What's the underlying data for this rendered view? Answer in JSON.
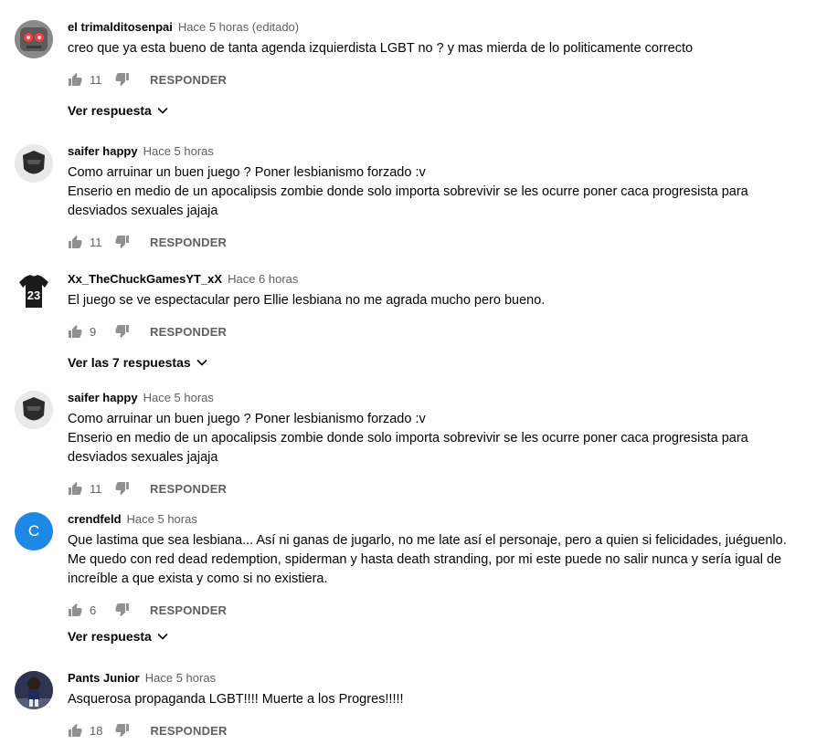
{
  "comments": [
    {
      "author": "el trimalditosenpai",
      "time": "Hace 5 horas (editado)",
      "text": "creo que ya esta bueno de tanta agenda izquierdista LGBT no ? y mas mierda de lo politicamente correcto",
      "likes": "11",
      "reply_label": "RESPONDER",
      "replies_toggle": "Ver respuesta",
      "avatar": "robot-avatar"
    },
    {
      "author": "saifer happy",
      "time": "Hace 5 horas",
      "text": "Como arruinar un buen juego ? Poner lesbianismo forzado :v\nEnserio en medio de un apocalipsis zombie donde solo importa sobrevivir se les ocurre poner caca progresista para desviados sexuales jajaja",
      "likes": "11",
      "reply_label": "RESPONDER",
      "avatar": "helmet-avatar"
    },
    {
      "author": "Xx_TheChuckGamesYT_xX",
      "time": "Hace 6 horas",
      "text": "El juego se ve espectacular pero Ellie lesbiana no me agrada mucho pero bueno.",
      "likes": "9",
      "reply_label": "RESPONDER",
      "replies_toggle": "Ver las 7 respuestas",
      "avatar": "jersey-avatar",
      "avatar_text": "23"
    },
    {
      "author": "saifer happy",
      "time": "Hace 5 horas",
      "text": "Como arruinar un buen juego ? Poner lesbianismo forzado :v\nEnserio en medio de un apocalipsis zombie donde solo importa sobrevivir se les ocurre poner caca progresista para desviados sexuales jajaja",
      "likes": "11",
      "reply_label": "RESPONDER",
      "avatar": "helmet-avatar"
    },
    {
      "author": "crendfeld",
      "time": "Hace 5 horas",
      "text": "Que lastima que sea lesbiana... Así ni ganas de jugarlo, no me late así el personaje, pero a quien si felicidades, juéguenlo.\nMe quedo con red dead redemption, spiderman y hasta death stranding, por mi este puede no salir nunca y sería igual de increíble a que exista y como si no existiera.",
      "likes": "6",
      "reply_label": "RESPONDER",
      "replies_toggle": "Ver respuesta",
      "avatar": "letter-avatar",
      "avatar_text": "C",
      "avatar_color": "#1e88e5"
    },
    {
      "author": "Pants Junior",
      "time": "Hace 5 horas",
      "text": "Asquerosa propaganda LGBT!!!! Muerte a los Progres!!!!!",
      "likes": "18",
      "reply_label": "RESPONDER",
      "avatar": "character-avatar"
    }
  ],
  "colors": {
    "author": "#030303",
    "secondary": "#606060",
    "icon": "#909090"
  }
}
